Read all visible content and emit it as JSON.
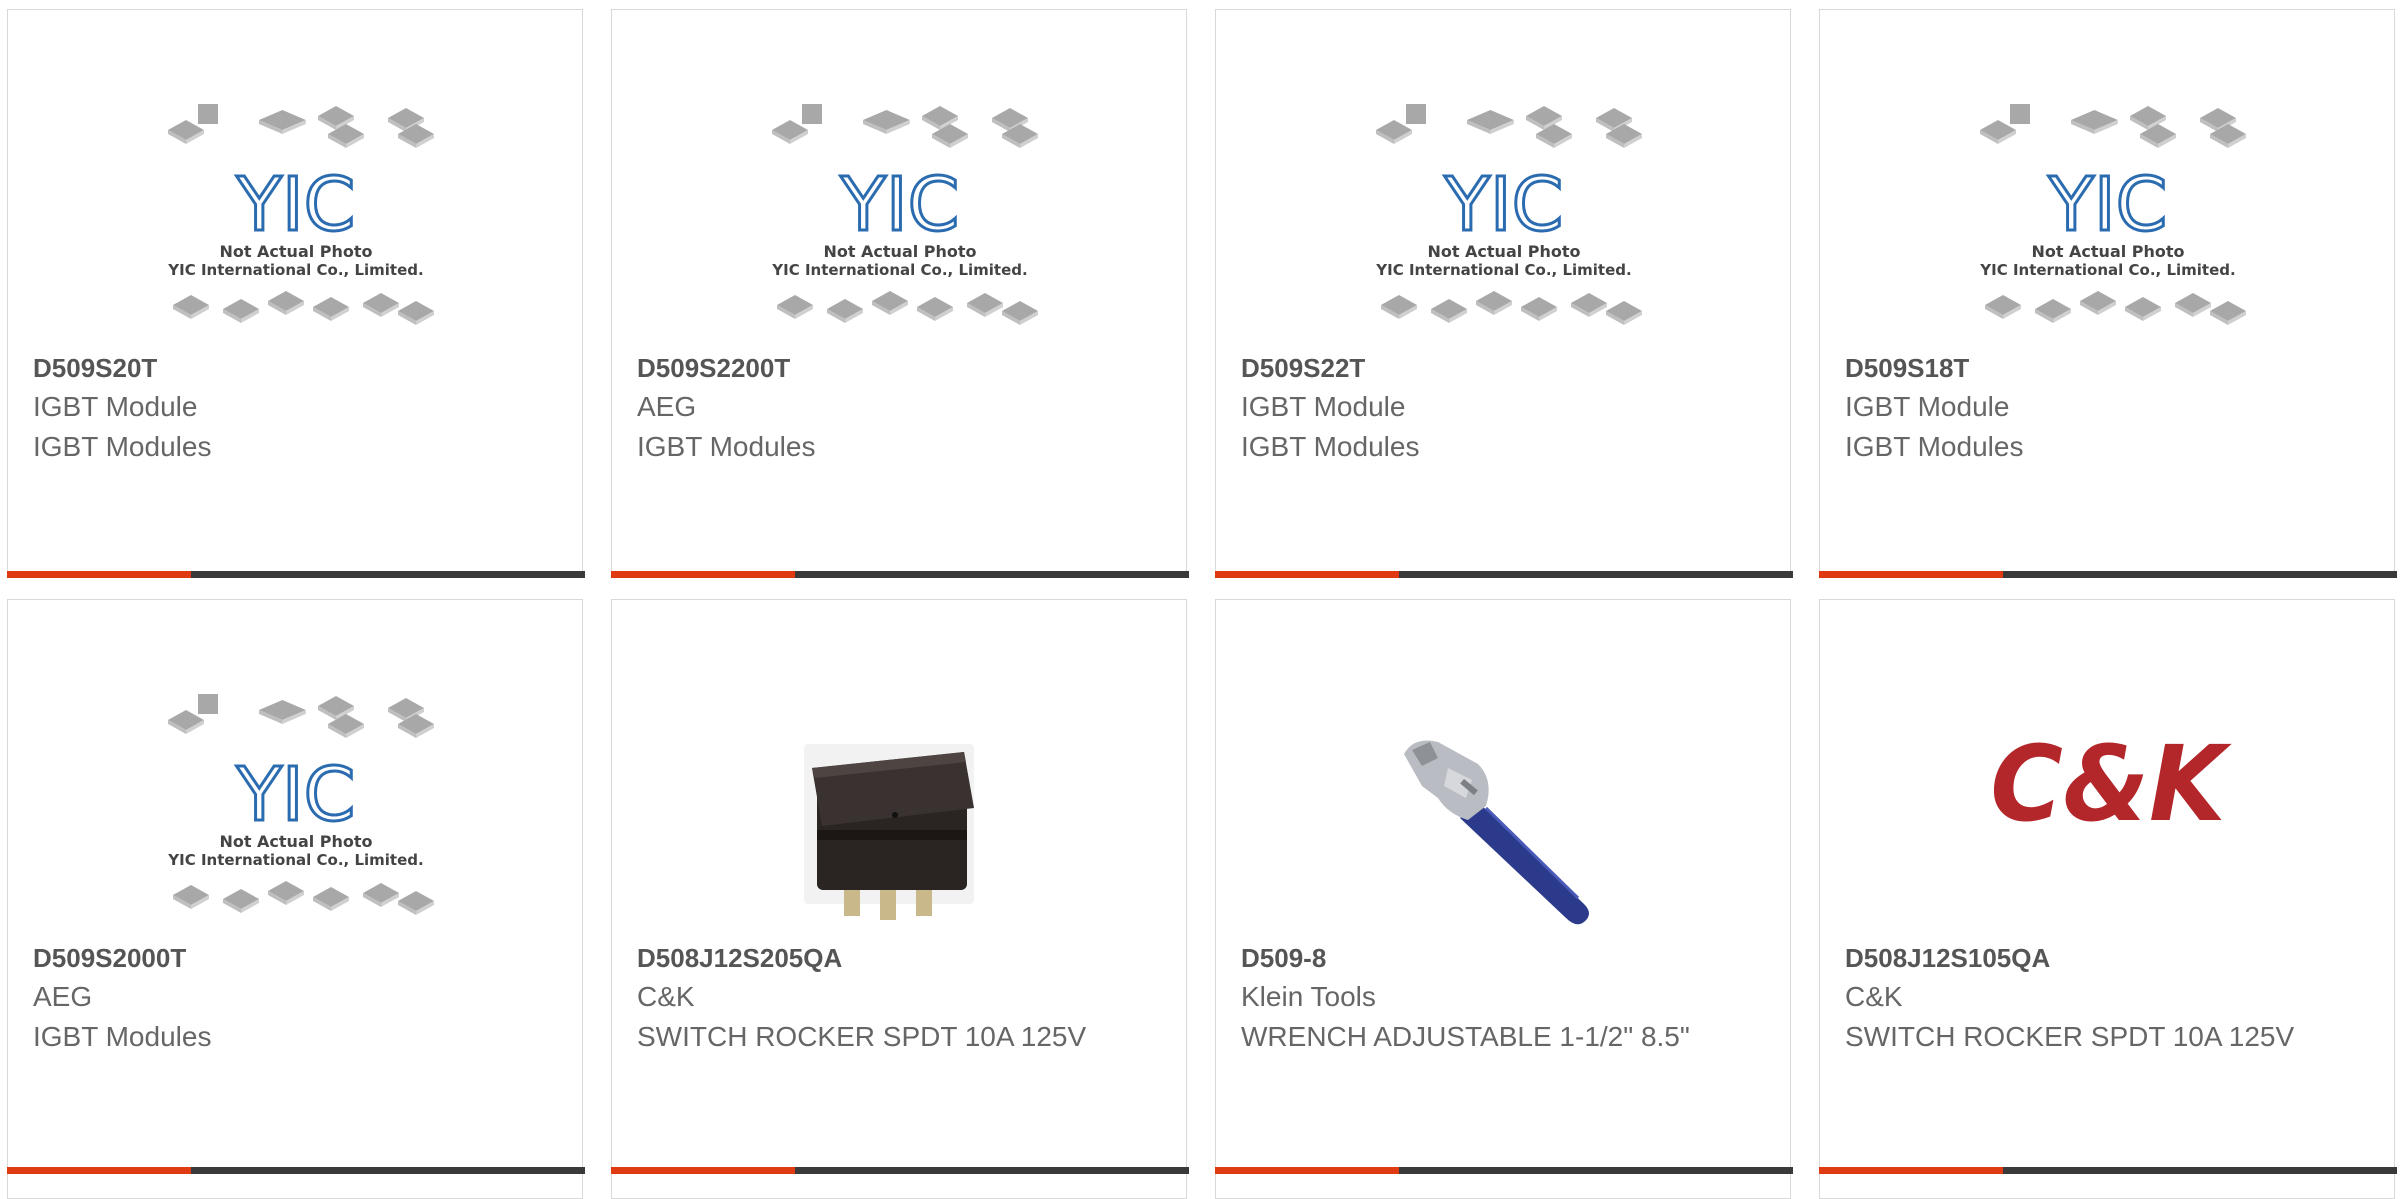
{
  "placeholder": {
    "brand": "YIC",
    "line1": "Not Actual Photo",
    "line2": "YIC International Co., Limited."
  },
  "products": [
    {
      "part": "D509S20T",
      "mfr": "IGBT Module",
      "desc": "IGBT Modules",
      "image": "yic-placeholder"
    },
    {
      "part": "D509S2200T",
      "mfr": "AEG",
      "desc": "IGBT Modules",
      "image": "yic-placeholder"
    },
    {
      "part": "D509S22T",
      "mfr": "IGBT Module",
      "desc": "IGBT Modules",
      "image": "yic-placeholder"
    },
    {
      "part": "D509S18T",
      "mfr": "IGBT Module",
      "desc": "IGBT Modules",
      "image": "yic-placeholder"
    },
    {
      "part": "D509S2000T",
      "mfr": "AEG",
      "desc": "IGBT Modules",
      "image": "yic-placeholder"
    },
    {
      "part": "D508J12S205QA",
      "mfr": "C&K",
      "desc": "SWITCH ROCKER SPDT 10A 125V",
      "image": "rocker-switch"
    },
    {
      "part": "D509-8",
      "mfr": "Klein Tools",
      "desc": "WRENCH ADJUSTABLE 1-1/2\" 8.5\"",
      "image": "adjustable-wrench"
    },
    {
      "part": "D508J12S105QA",
      "mfr": "C&K",
      "desc": "SWITCH ROCKER SPDT 10A 125V",
      "image": "ck-logo"
    }
  ],
  "ck_logo_text": "C&K",
  "colors": {
    "accent": "#e03a12",
    "bar": "#3a3a3a",
    "border": "#d9d9d9"
  }
}
